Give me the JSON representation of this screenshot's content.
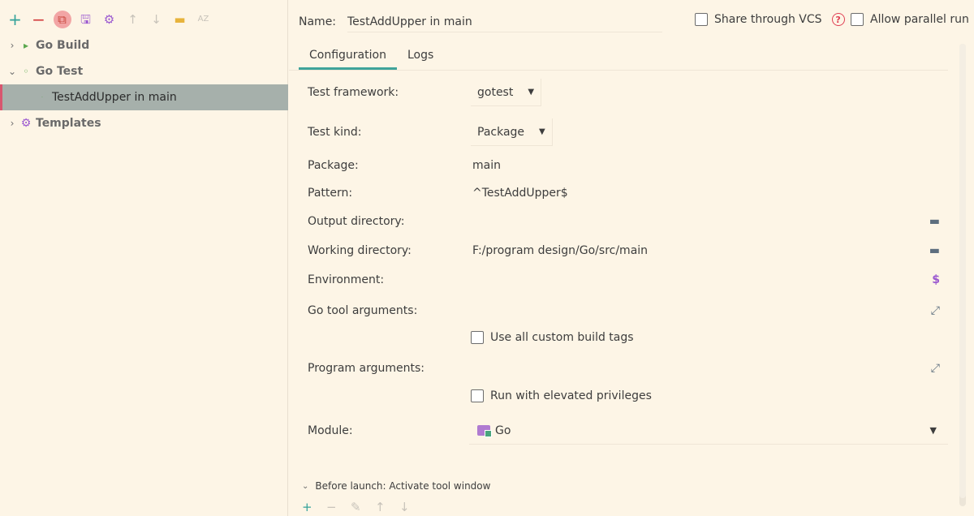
{
  "toolbar": {
    "add": "+",
    "remove": "−",
    "copy": "⧉",
    "save": "🖫",
    "settings": "⚙",
    "up": "↑",
    "down": "↓",
    "folder": "▬",
    "sort": "AZ"
  },
  "tree": [
    {
      "label": "Go Build",
      "expanded": false
    },
    {
      "label": "Go Test",
      "expanded": true
    },
    {
      "label": "TestAddUpper in main",
      "selected": true
    },
    {
      "label": "Templates",
      "expanded": false
    }
  ],
  "name": {
    "label": "Name:",
    "value": "TestAddUpper in main"
  },
  "share": {
    "label": "Share through VCS",
    "help": "?"
  },
  "parallel": {
    "label": "Allow parallel run"
  },
  "tabs": [
    {
      "label": "Configuration"
    },
    {
      "label": "Logs"
    }
  ],
  "form": {
    "test_framework": {
      "label": "Test framework:",
      "value": "gotest"
    },
    "test_kind": {
      "label": "Test kind:",
      "value": "Package"
    },
    "package": {
      "label": "Package:",
      "value": "main"
    },
    "pattern": {
      "label": "Pattern:",
      "value": "^TestAddUpper$"
    },
    "output_dir": {
      "label": "Output directory:",
      "value": ""
    },
    "working_dir": {
      "label": "Working directory:",
      "value": "F:/program design/Go/src/main"
    },
    "environment": {
      "label": "Environment:",
      "value": ""
    },
    "go_tool_args": {
      "label": "Go tool arguments:",
      "value": ""
    },
    "custom_build_tags": {
      "label": "Use all custom build tags",
      "checked": false
    },
    "program_args": {
      "label": "Program arguments:",
      "value": ""
    },
    "elevated": {
      "label": "Run with elevated privileges",
      "checked": false
    },
    "module": {
      "label": "Module:",
      "value": "Go"
    }
  },
  "before_launch": {
    "label": "Before launch: Activate tool window"
  },
  "colors": {
    "accent": "#3fa39a",
    "selection": "#a6b0ab",
    "background": "#fdf5e6"
  }
}
